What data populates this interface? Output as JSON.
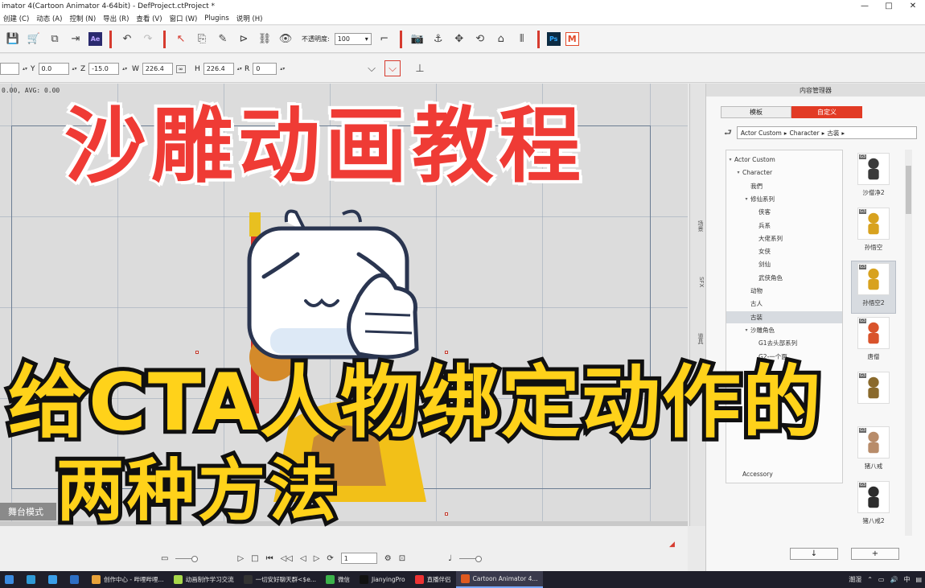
{
  "window": {
    "title": "imator 4(Cartoon Animator 4-64bit) - DefProject.ctProject *",
    "controls": [
      "—",
      "□",
      "✕"
    ]
  },
  "menu": [
    "创建 (C)",
    "动态 (A)",
    "控制 (N)",
    "导出 (R)",
    "查看 (V)",
    "窗口 (W)",
    "Plugins",
    "说明 (H)"
  ],
  "toolbar": {
    "opacity_label": "不透明度:",
    "opacity_value": "100",
    "badges": {
      "ae": "Ae",
      "ps": "Ps",
      "m": "M"
    }
  },
  "properties": {
    "x_value": "",
    "y_label": "Y",
    "y_value": "0.0",
    "z_label": "Z",
    "z_value": "-15.0",
    "w_label": "W",
    "w_value": "226.4",
    "h_label": "H",
    "h_value": "226.4",
    "r_label": "R",
    "r_value": "0"
  },
  "stage": {
    "readout": "0.00, AVG: 0.00",
    "mode_label": "舞台模式"
  },
  "playback": {
    "frame": "1"
  },
  "dock_tabs": [
    "场景",
    "SFX",
    "道具"
  ],
  "content_manager": {
    "title": "内容管理器",
    "tabs": [
      "模板",
      "自定义"
    ],
    "breadcrumb": [
      "Actor Custom",
      "Character",
      "古装"
    ],
    "tree": [
      {
        "label": "Actor Custom",
        "level": 0,
        "caret": "▾"
      },
      {
        "label": "Character",
        "level": 1,
        "caret": "▾"
      },
      {
        "label": "我們",
        "level": 2,
        "caret": ""
      },
      {
        "label": "修仙系列",
        "level": 2,
        "caret": "▾"
      },
      {
        "label": "侠客",
        "level": 3,
        "caret": ""
      },
      {
        "label": "兵系",
        "level": 3,
        "caret": ""
      },
      {
        "label": "大佬系列",
        "level": 3,
        "caret": ""
      },
      {
        "label": "女侠",
        "level": 3,
        "caret": ""
      },
      {
        "label": "剑仙",
        "level": 3,
        "caret": ""
      },
      {
        "label": "武侠角色",
        "level": 3,
        "caret": ""
      },
      {
        "label": "动物",
        "level": 2,
        "caret": ""
      },
      {
        "label": "古人",
        "level": 2,
        "caret": ""
      },
      {
        "label": "古装",
        "level": 2,
        "caret": "",
        "selected": true
      },
      {
        "label": "沙雕角色",
        "level": 2,
        "caret": "▾"
      },
      {
        "label": "G1去头部系列",
        "level": 3,
        "caret": ""
      },
      {
        "label": "G2-一个面",
        "level": 3,
        "caret": ""
      },
      {
        "label": "G3",
        "level": 3,
        "caret": ""
      },
      {
        "label": "",
        "level": 3,
        "caret": ""
      },
      {
        "label": "",
        "level": 3,
        "caret": ""
      },
      {
        "label": "",
        "level": 3,
        "caret": ""
      },
      {
        "label": "",
        "level": 3,
        "caret": ""
      },
      {
        "label": "",
        "level": 3,
        "caret": ""
      },
      {
        "label": "",
        "level": 3,
        "caret": ""
      },
      {
        "label": "",
        "level": 3,
        "caret": ""
      },
      {
        "label": "Accessory",
        "level": 1,
        "caret": ""
      }
    ],
    "thumbnails": [
      {
        "name": "沙僧净2",
        "tag": "G3",
        "color": "#3a3a3a"
      },
      {
        "name": "孙悟空",
        "tag": "G3",
        "color": "#d8a21e"
      },
      {
        "name": "孙悟空2",
        "tag": "G3",
        "color": "#d8a21e",
        "selected": true
      },
      {
        "name": "唐僧",
        "tag": "G3",
        "color": "#d9532b"
      },
      {
        "name": "",
        "tag": "G3",
        "color": "#8a6a2c"
      },
      {
        "name": "猪八戒",
        "tag": "G3",
        "color": "#b88c6a"
      },
      {
        "name": "猪八戒2",
        "tag": "G3",
        "color": "#2d2d2d"
      }
    ],
    "buttons": [
      "↓",
      "+"
    ]
  },
  "overlay": {
    "headline": "沙雕动画教程",
    "subline": "给CTA人物绑定动作的",
    "subline2": "两种方法"
  },
  "taskbar": {
    "items": [
      {
        "label": "",
        "color": "#3b8be0"
      },
      {
        "label": "",
        "color": "#2f9ad6"
      },
      {
        "label": "",
        "color": "#3a9ee8"
      },
      {
        "label": "",
        "color": "#2d6fc4"
      },
      {
        "label": "创作中心 - 哔哩哔哩...",
        "color": "#e8a23a"
      },
      {
        "label": "动画制作学习交流",
        "color": "#a8d84a"
      },
      {
        "label": "一切安好聊天群<$e...",
        "color": "#333"
      },
      {
        "label": "微信",
        "color": "#3cb34a"
      },
      {
        "label": "JianyingPro",
        "color": "#111"
      },
      {
        "label": "直播伴侣",
        "color": "#e33"
      },
      {
        "label": "Cartoon Animator 4...",
        "color": "#e05a1f",
        "active": true
      }
    ],
    "tray": {
      "weather": "潮湿",
      "lang": "中"
    }
  }
}
